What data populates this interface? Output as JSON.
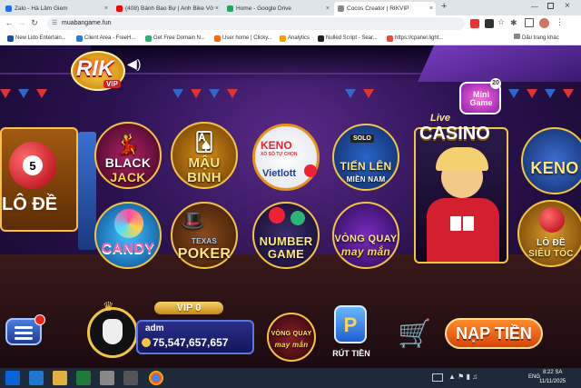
{
  "browser": {
    "tabs": [
      {
        "label": "Zalo - Hà Lâm Giem",
        "color": "#1e6ff5"
      },
      {
        "label": "(408) Bánh Bao Bự | Anh Bike Vở",
        "color": "#ff0000"
      },
      {
        "label": "Home - Google Drive",
        "color": "#1fa463"
      },
      {
        "label": "Cocos Creator | RIKVIP",
        "color": "#888888"
      }
    ],
    "new_tab": "+",
    "url": "muabangame.fun",
    "bookmarks": [
      {
        "label": "New Lido Entertain...",
        "color": "#1a4fa0"
      },
      {
        "label": "Client Area - FreeH...",
        "color": "#2a7dd1"
      },
      {
        "label": "Get Free Domain N...",
        "color": "#2bb673"
      },
      {
        "label": "User home | Clicky...",
        "color": "#ff6a00"
      },
      {
        "label": "Analytics",
        "color": "#f4a000"
      },
      {
        "label": "Nulled Script - Sear...",
        "color": "#222222"
      },
      {
        "label": "https://cpanel.light...",
        "color": "#e94b35"
      }
    ],
    "bookmarks_other": "Dấu trang khác"
  },
  "game": {
    "logo": "RIK",
    "logo_sub": "VIP",
    "tiles": {
      "lode": "LÔ ĐỀ",
      "lode_ball": "5",
      "blackjack_1": "BLACK",
      "blackjack_2": "JACK",
      "maubinh_1": "MẬU",
      "maubinh_2": "BINH",
      "keno_vietlott_top": "KENO",
      "keno_vietlott_sub": "XỔ SỐ TỰ CHỌN",
      "vietlott": "Vietlott",
      "tienlen_badge": "SOLO",
      "tienlen_1": "TIẾN LÊN",
      "tienlen_2": "MIỀN NAM",
      "candy": "CANDY",
      "poker_top": "TEXAS",
      "poker": "POKER",
      "number_1": "NUMBER",
      "number_2": "GAME",
      "vongquay_1": "VÒNG QUAY",
      "vongquay_2": "may mắn",
      "live": "Live",
      "casino": "CASINO",
      "minigame": "Mini Game",
      "minigame_count": "20",
      "keno_right": "KENO",
      "lode_sieutoc_1": "LÔ ĐỀ",
      "lode_sieutoc_2": "SIÊU TỐC"
    },
    "user": {
      "vip_label": "VIP 0",
      "name": "adm",
      "balance": "75,547,657,657"
    },
    "bottom": {
      "vongquay_1": "VÒNG QUAY",
      "vongquay_2": "may mắn",
      "rut_tien_icon": "P",
      "rut_tien": "RÚT TIỀN",
      "nap_tien": "NẠP TIỀN"
    }
  },
  "taskbar": {
    "lang": "ENG",
    "time": "8:22 SA",
    "date": "11/11/2025"
  }
}
